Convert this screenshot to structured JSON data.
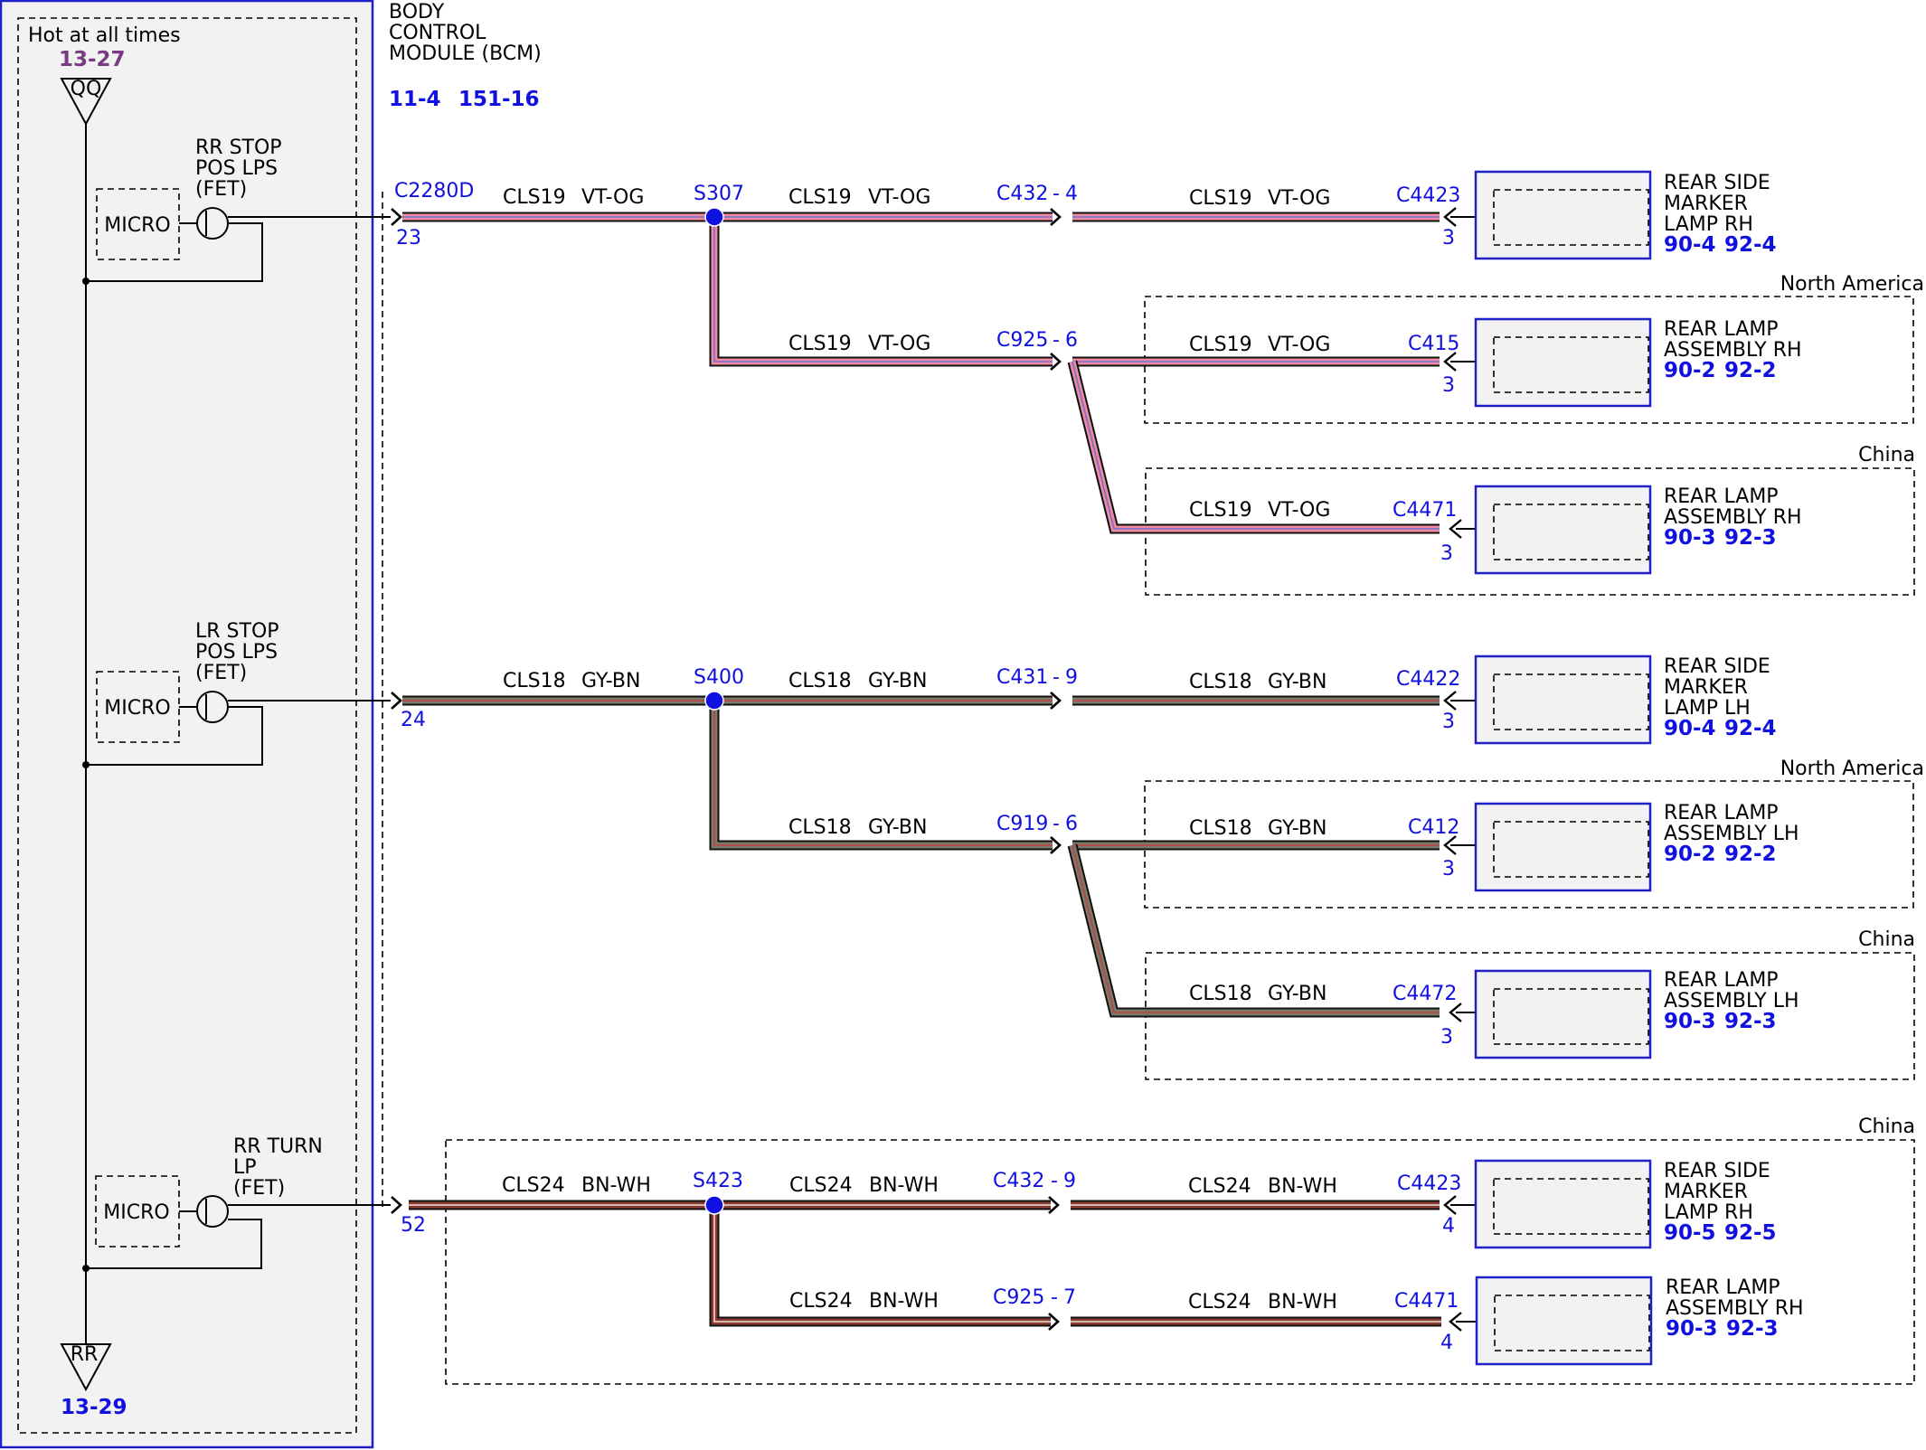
{
  "colors": {
    "connector_blue": "#1010e0",
    "ref_purple": "#7a3a84",
    "wire_vt_og": "#f08a9e",
    "wire_gy_bn": "#7a7a6a",
    "wire_bn_wh": "#8a3a30",
    "module_fill": "#f2f2f2",
    "module_border": "#2020c8"
  },
  "power": {
    "label": "Hot at all times",
    "top_ref": "13-27",
    "top_terminal": "QQ",
    "bottom_terminal": "RR",
    "bottom_ref": "13-29"
  },
  "module": {
    "name_lines": [
      "BODY",
      "CONTROL",
      "MODULE (BCM)"
    ],
    "refs": [
      "11-4",
      "151-16"
    ],
    "connector": "C2280D"
  },
  "drivers": [
    {
      "name_lines": [
        "RR STOP",
        "POS LPS",
        "(FET)"
      ],
      "micro": "MICRO",
      "pin": "23"
    },
    {
      "name_lines": [
        "LR STOP",
        "POS LPS",
        "(FET)"
      ],
      "micro": "MICRO",
      "pin": "24"
    },
    {
      "name_lines": [
        "RR TURN",
        "LP",
        "(FET)"
      ],
      "micro": "MICRO",
      "pin": "52"
    }
  ],
  "circuits": [
    {
      "splice": "S307",
      "segments": [
        {
          "circuit": "CLS19",
          "color": "VT-OG"
        },
        {
          "circuit": "CLS19",
          "color": "VT-OG"
        },
        {
          "circuit": "CLS19",
          "color": "VT-OG"
        },
        {
          "circuit": "CLS19",
          "color": "VT-OG"
        },
        {
          "circuit": "CLS19",
          "color": "VT-OG"
        },
        {
          "circuit": "CLS19",
          "color": "VT-OG"
        }
      ],
      "inline": [
        {
          "connector": "C432",
          "pin": "4"
        },
        {
          "connector": "C925",
          "pin": "6"
        }
      ],
      "loads": [
        {
          "connector": "C4423",
          "pin": "3",
          "name_lines": [
            "REAR SIDE",
            "MARKER",
            "LAMP RH"
          ],
          "refs": [
            "90-4",
            "92-4"
          ]
        },
        {
          "connector": "C415",
          "pin": "3",
          "name_lines": [
            "REAR LAMP",
            "ASSEMBLY RH"
          ],
          "refs": [
            "90-2",
            "92-2"
          ],
          "variant": "North America"
        },
        {
          "connector": "C4471",
          "pin": "3",
          "name_lines": [
            "REAR LAMP",
            "ASSEMBLY RH"
          ],
          "refs": [
            "90-3",
            "92-3"
          ],
          "variant": "China"
        }
      ]
    },
    {
      "splice": "S400",
      "segments": [
        {
          "circuit": "CLS18",
          "color": "GY-BN"
        },
        {
          "circuit": "CLS18",
          "color": "GY-BN"
        },
        {
          "circuit": "CLS18",
          "color": "GY-BN"
        },
        {
          "circuit": "CLS18",
          "color": "GY-BN"
        },
        {
          "circuit": "CLS18",
          "color": "GY-BN"
        },
        {
          "circuit": "CLS18",
          "color": "GY-BN"
        }
      ],
      "inline": [
        {
          "connector": "C431",
          "pin": "9"
        },
        {
          "connector": "C919",
          "pin": "6"
        }
      ],
      "loads": [
        {
          "connector": "C4422",
          "pin": "3",
          "name_lines": [
            "REAR SIDE",
            "MARKER",
            "LAMP LH"
          ],
          "refs": [
            "90-4",
            "92-4"
          ]
        },
        {
          "connector": "C412",
          "pin": "3",
          "name_lines": [
            "REAR LAMP",
            "ASSEMBLY LH"
          ],
          "refs": [
            "90-2",
            "92-2"
          ],
          "variant": "North America"
        },
        {
          "connector": "C4472",
          "pin": "3",
          "name_lines": [
            "REAR LAMP",
            "ASSEMBLY LH"
          ],
          "refs": [
            "90-3",
            "92-3"
          ],
          "variant": "China"
        }
      ]
    },
    {
      "splice": "S423",
      "variant": "China",
      "segments": [
        {
          "circuit": "CLS24",
          "color": "BN-WH"
        },
        {
          "circuit": "CLS24",
          "color": "BN-WH"
        },
        {
          "circuit": "CLS24",
          "color": "BN-WH"
        },
        {
          "circuit": "CLS24",
          "color": "BN-WH"
        },
        {
          "circuit": "CLS24",
          "color": "BN-WH"
        }
      ],
      "inline": [
        {
          "connector": "C432",
          "pin": "9"
        },
        {
          "connector": "C925",
          "pin": "7"
        }
      ],
      "loads": [
        {
          "connector": "C4423",
          "pin": "4",
          "name_lines": [
            "REAR SIDE",
            "MARKER",
            "LAMP RH"
          ],
          "refs": [
            "90-5",
            "92-5"
          ]
        },
        {
          "connector": "C4471",
          "pin": "4",
          "name_lines": [
            "REAR LAMP",
            "ASSEMBLY RH"
          ],
          "refs": [
            "90-3",
            "92-3"
          ]
        }
      ]
    }
  ]
}
